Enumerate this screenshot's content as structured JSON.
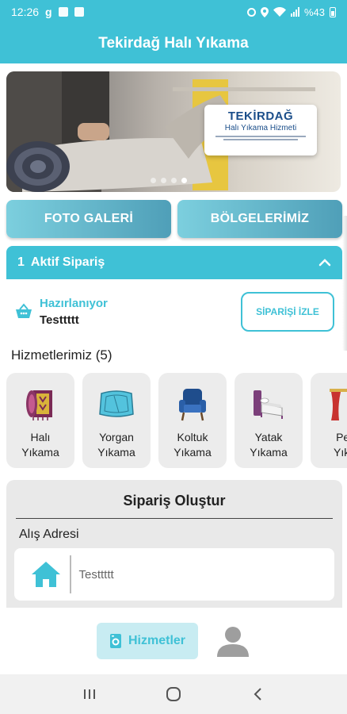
{
  "status_bar": {
    "time": "12:26",
    "battery": "%43"
  },
  "app_bar": {
    "title": "Tekirdağ Halı Yıkama"
  },
  "banner": {
    "card_title": "TEKİRDAĞ",
    "card_subtitle": "Halı Yıkama Hizmeti",
    "dots": 4,
    "active_dot": 4
  },
  "buttons": {
    "gallery": "FOTO GALERİ",
    "regions": "BÖLGELERİMİZ"
  },
  "active_order": {
    "count": "1",
    "label": "Aktif Sipariş",
    "status": "Hazırlanıyor",
    "customer": "Testtttt",
    "track_button": "SİPARİŞİ İZLE"
  },
  "services": {
    "title": "Hizmetlerimiz (5)",
    "items": [
      {
        "line1": "Halı",
        "line2": "Yıkama",
        "icon": "carpet-icon"
      },
      {
        "line1": "Yorgan",
        "line2": "Yıkama",
        "icon": "quilt-icon"
      },
      {
        "line1": "Koltuk",
        "line2": "Yıkama",
        "icon": "armchair-icon"
      },
      {
        "line1": "Yatak",
        "line2": "Yıkama",
        "icon": "bed-icon"
      },
      {
        "line1": "Per",
        "line2": "Yıka",
        "icon": "curtain-icon"
      }
    ]
  },
  "create_order": {
    "title": "Sipariş Oluştur",
    "address_label": "Alış Adresi",
    "address_value": "Testtttt"
  },
  "bottom_nav": {
    "services_label": "Hizmetler"
  },
  "colors": {
    "primary": "#3fc1d6",
    "nav_active_bg": "#c8ecf2"
  }
}
